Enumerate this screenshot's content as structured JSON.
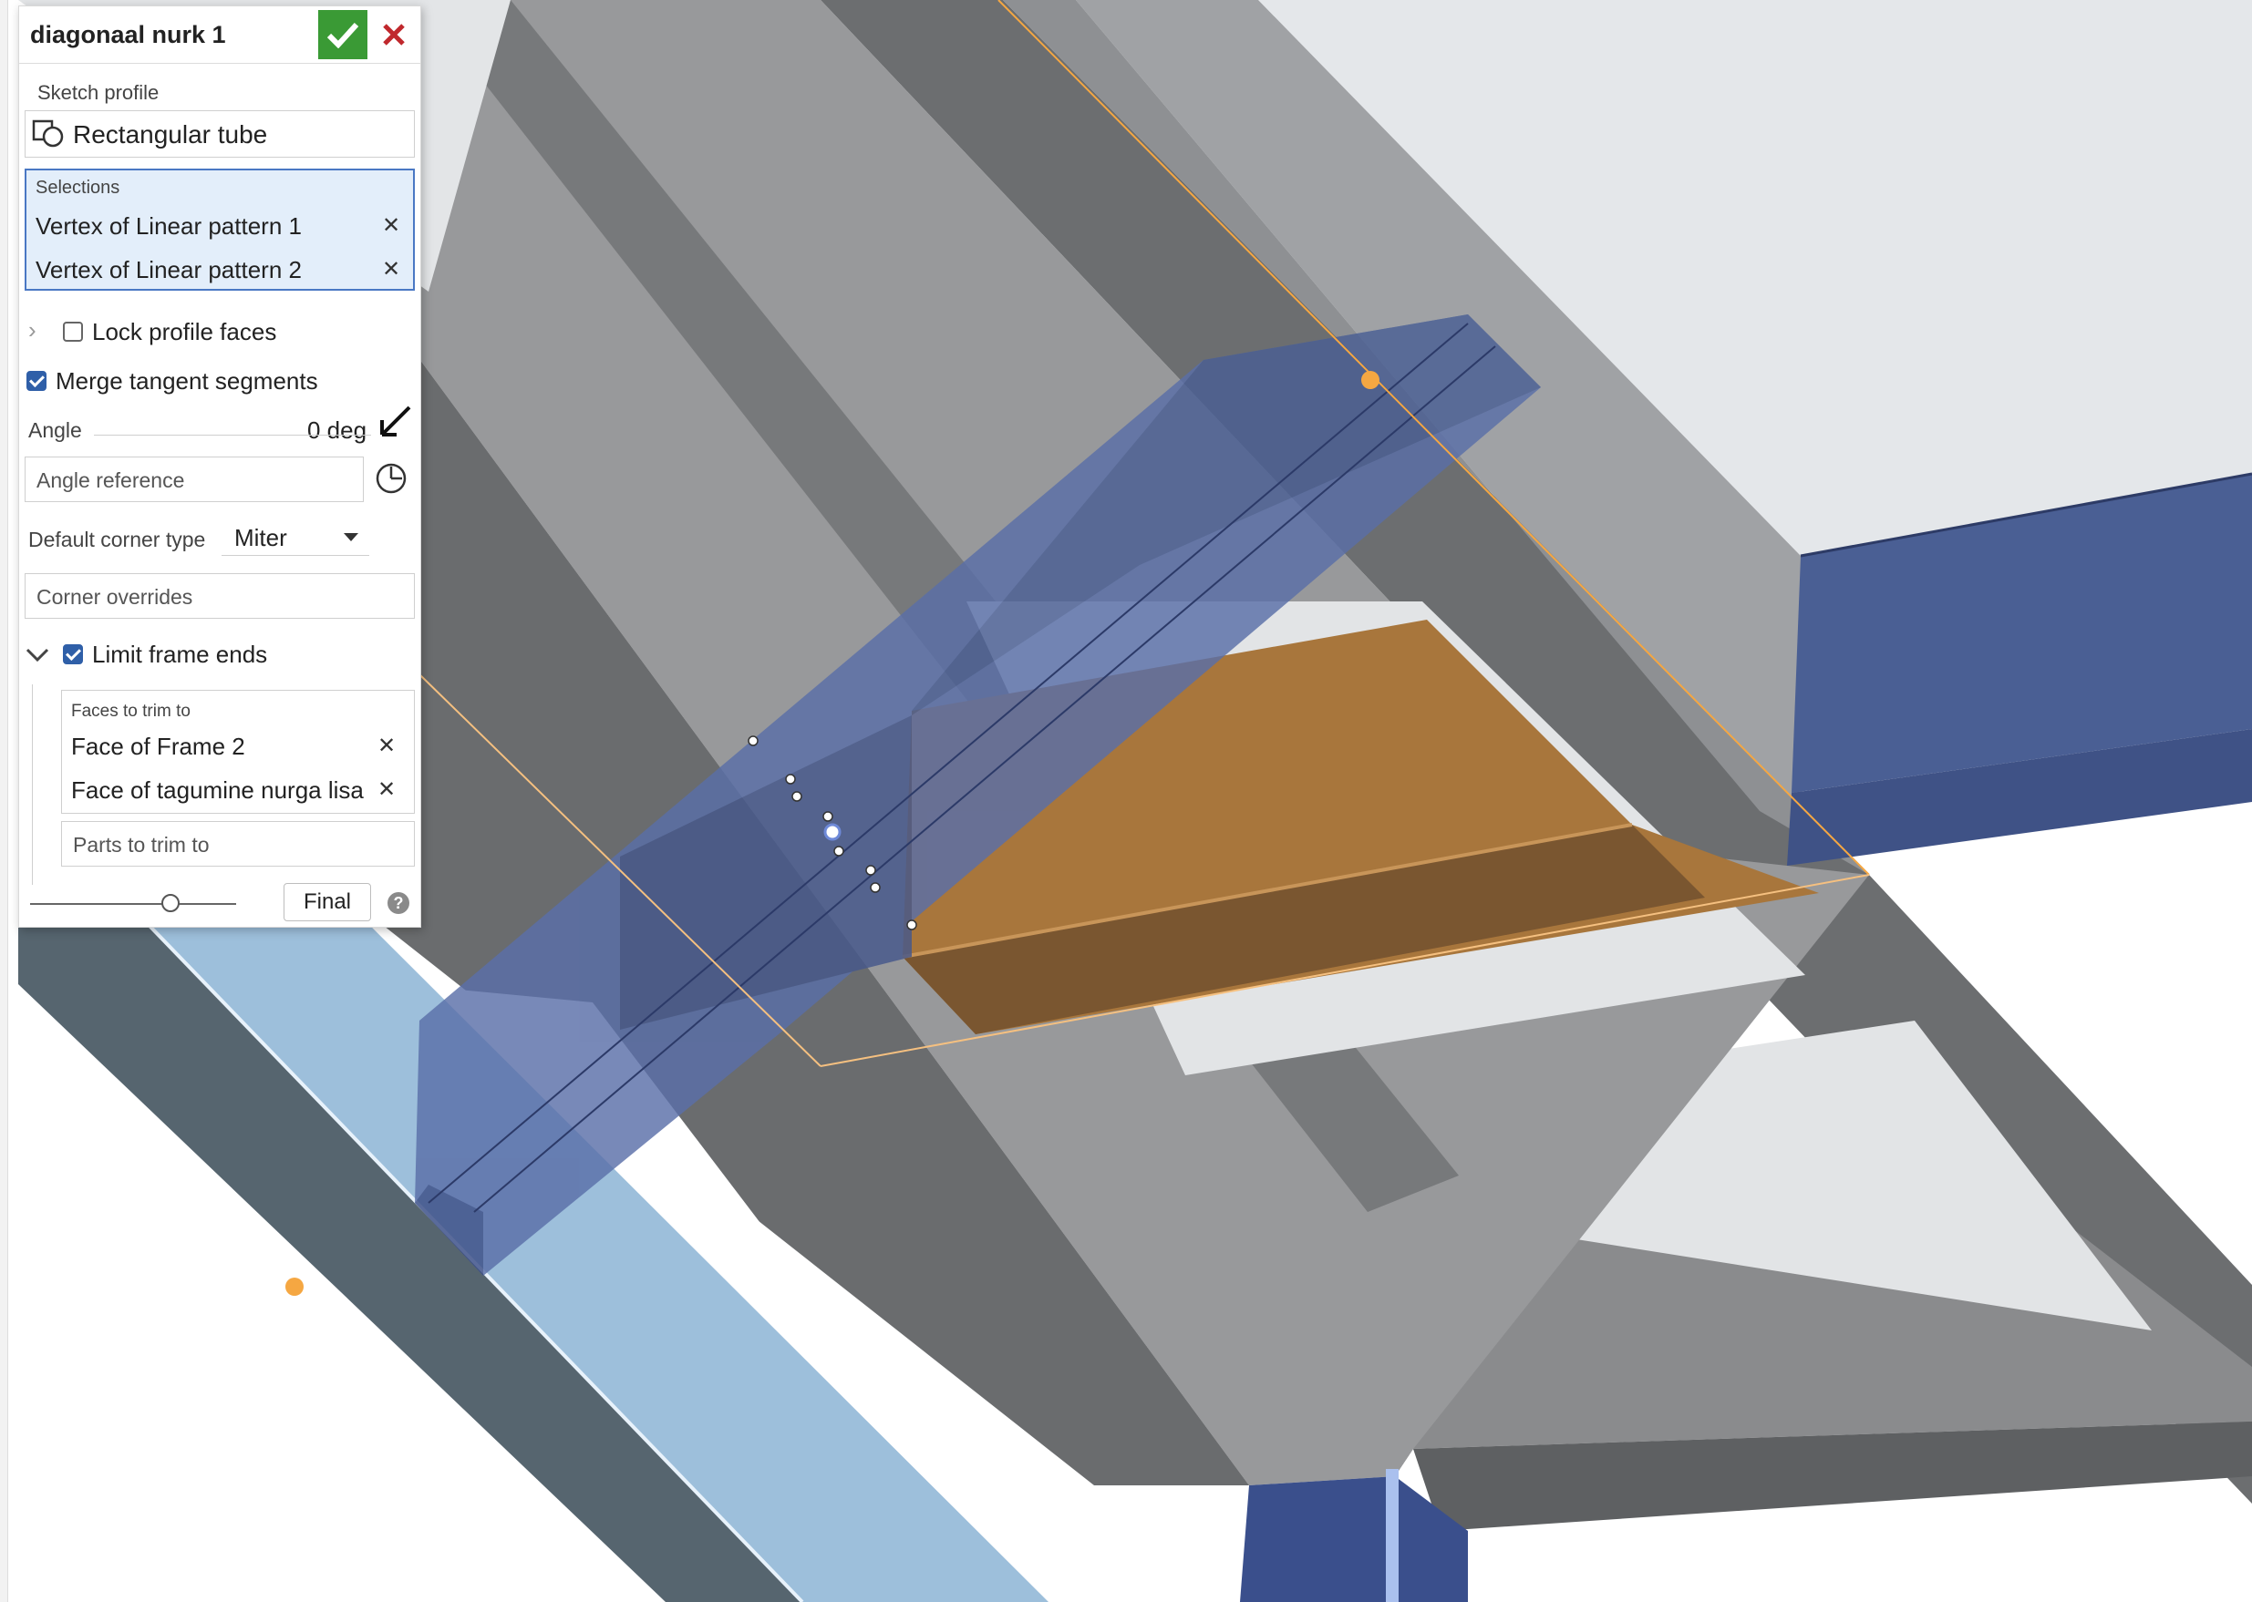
{
  "dialog": {
    "title": "diagonaal nurk 1",
    "sketch_profile_label": "Sketch profile",
    "sketch_profile_value": "Rectangular tube",
    "selections_label": "Selections",
    "selections": [
      "Vertex of Linear pattern 1",
      "Vertex of Linear pattern 2"
    ],
    "lock_profile_faces": {
      "label": "Lock profile faces",
      "checked": false
    },
    "merge_tangent_segments": {
      "label": "Merge tangent segments",
      "checked": true
    },
    "angle": {
      "label": "Angle",
      "value": "0 deg"
    },
    "angle_reference_placeholder": "Angle reference",
    "default_corner_type": {
      "label": "Default corner type",
      "value": "Miter"
    },
    "corner_overrides_placeholder": "Corner overrides",
    "limit_frame_ends": {
      "label": "Limit frame ends",
      "checked": true
    },
    "faces_to_trim_label": "Faces to trim to",
    "faces_to_trim": [
      "Face of Frame 2",
      "Face of tagumine nurga lisa"
    ],
    "parts_to_trim_placeholder": "Parts to trim to",
    "final_button": "Final",
    "help": "?"
  },
  "colors": {
    "accept": "#3a9a35",
    "cancel": "#c0282d",
    "selection_bg": "#e3eefa",
    "selection_border": "#4a78c4",
    "frame_blue": "#4a5f94",
    "tube_preview": "#5a6fa8",
    "part_orange": "#a8763c",
    "light_blue_frame": "#9dbfdb",
    "highlight": "#f5a742"
  }
}
